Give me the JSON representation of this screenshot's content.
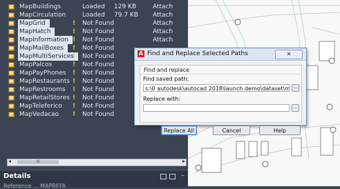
{
  "xrefs": [
    {
      "name": "MapBuildings",
      "status": "Loaded",
      "size": "129 KB",
      "type": "Attach",
      "warn": "",
      "selected": false
    },
    {
      "name": "MapCirculation",
      "status": "Loaded",
      "size": "79.7 KB",
      "type": "Attach",
      "warn": "",
      "selected": false
    },
    {
      "name": "MapGrid",
      "status": "Not Found",
      "size": "",
      "type": "Attach",
      "warn": "!",
      "selected": true
    },
    {
      "name": "MapHatch",
      "status": "Not Found",
      "size": "",
      "type": "Attach",
      "warn": "!",
      "selected": true
    },
    {
      "name": "MapInformation",
      "status": "Not Found",
      "size": "",
      "type": "Attach",
      "warn": "!",
      "selected": true
    },
    {
      "name": "MapMailBoxes",
      "status": "Not Found",
      "size": "",
      "type": "",
      "warn": "!",
      "selected": true
    },
    {
      "name": "MapMultiServices",
      "status": "Not Found",
      "size": "",
      "type": "",
      "warn": "!",
      "selected": true
    },
    {
      "name": "MapPalcos",
      "status": "Not Found",
      "size": "",
      "type": "",
      "warn": "!",
      "selected": false
    },
    {
      "name": "MapPayPhones",
      "status": "Not Found",
      "size": "",
      "type": "",
      "warn": "!",
      "selected": false
    },
    {
      "name": "MapRestaurants",
      "status": "Not Found",
      "size": "",
      "type": "",
      "warn": "!",
      "selected": false
    },
    {
      "name": "MapRestrooms",
      "status": "Not Found",
      "size": "",
      "type": "",
      "warn": "!",
      "selected": false
    },
    {
      "name": "MapRetailStores",
      "status": "Not Found",
      "size": "",
      "type": "",
      "warn": "!",
      "selected": false
    },
    {
      "name": "MapTeleferico",
      "status": "Not Found",
      "size": "",
      "type": "",
      "warn": "!",
      "selected": false
    },
    {
      "name": "MapVedacao",
      "status": "Not Found",
      "size": "",
      "type": "",
      "warn": "!",
      "selected": false
    }
  ],
  "scrollbar": {
    "thumb_label": "III",
    "left_arrow": "◂",
    "right_arrow": "▸"
  },
  "details": {
    "title": "Details",
    "collapse_glyph": "–",
    "partial_text": "Reference ... MAPREFA"
  },
  "dialog": {
    "title": "Find and Replace Selected Paths",
    "close_glyph": "✕",
    "group_label": "Find and replace",
    "find_label": "Find saved path:",
    "find_value": "s:\\0 autodesk\\autocad 2018\\launch demo\\dataset\\mapxrefs",
    "replace_label": "Replace with:",
    "replace_value": "",
    "browse_glyph": "...",
    "buttons": {
      "replace_all": "Replace All",
      "cancel": "Cancel",
      "help": "Help"
    }
  },
  "colors": {
    "warning": "#f2c14e",
    "file_icon": "#e6b63a",
    "app_icon": "#d62424"
  }
}
